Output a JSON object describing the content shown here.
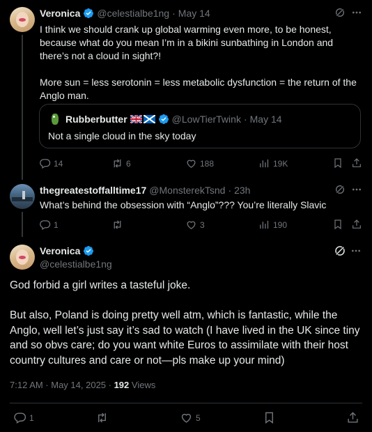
{
  "tweet1": {
    "name": "Veronica",
    "handle": "@celestialbe1ng",
    "sep": "·",
    "date": "May 14",
    "text": "I think we should crank up global warming even more, to be honest, because what do you mean I’m in a bikini sunbathing in London and there’s not a cloud in sight?!\n\nMore sun = less serotonin = less metabolic dysfunction = the return of the Anglo man.",
    "quote": {
      "name": "Rubberbutter",
      "flags": "🇬🇧🏴",
      "handle": "@LowTierTwink",
      "sep": "·",
      "date": "May 14",
      "text": "Not a single cloud in the sky today"
    },
    "replies": "14",
    "reposts": "6",
    "likes": "188",
    "views": "19K"
  },
  "tweet2": {
    "name": "thegreatestoffalltime17",
    "handle": "@MonsterekTsnd",
    "sep": "·",
    "time": "23h",
    "text": "What’s behind the obsession with “Anglo”??? You’re literally Slavic",
    "replies": "1",
    "reposts": "",
    "likes": "3",
    "views": "190"
  },
  "main": {
    "name": "Veronica",
    "handle": "@celestialbe1ng",
    "text": "God forbid a girl writes a tasteful joke.\n\nBut also, Poland is doing pretty well atm, which is fantastic, while the Anglo, well let’s just say it’s sad to watch (I have lived in the UK since tiny and so obvs care; do you want white Euros to assimilate with their host country cultures and care or not—pls make up your mind)",
    "timestamp": "7:12 AM · May 14, 2025 · ",
    "views_count": "192",
    "views_label": " Views",
    "replies": "1",
    "likes": "5"
  },
  "colors": {
    "verified": "#1d9bf0",
    "muted": "#71767b",
    "text": "#e7e9ea",
    "border": "#2f3336"
  }
}
